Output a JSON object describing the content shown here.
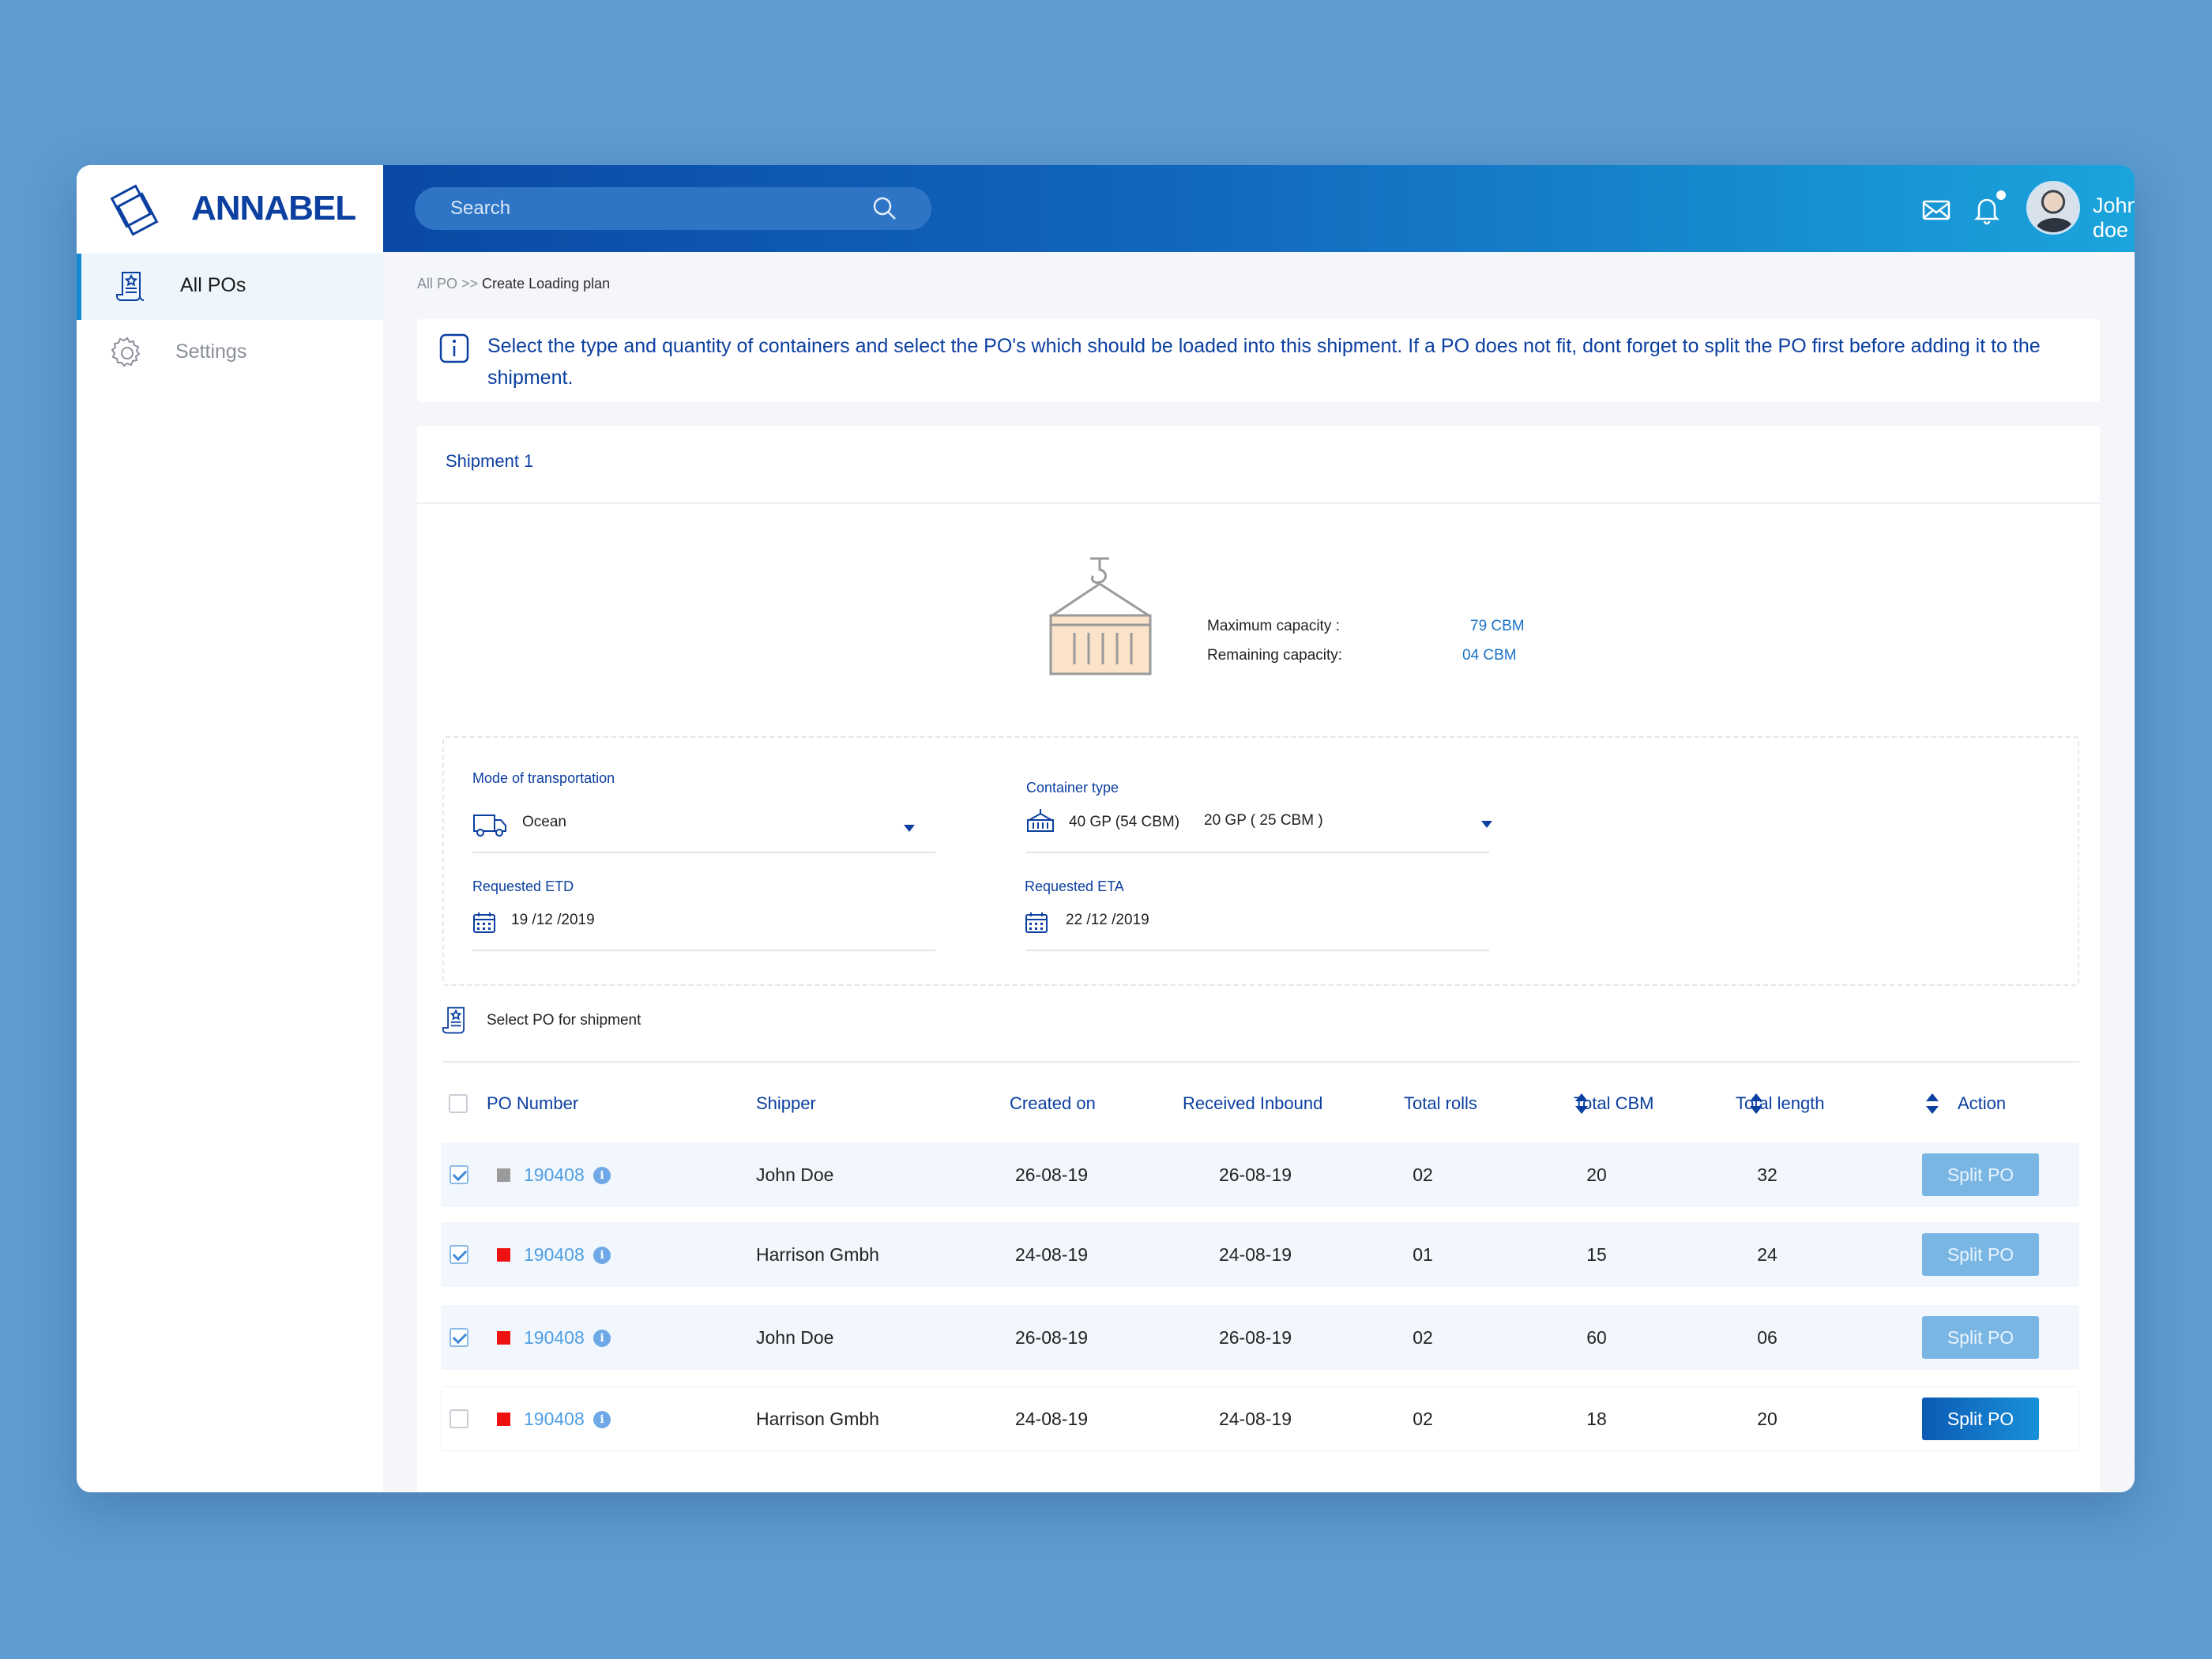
{
  "brand": {
    "name": "ANNABEL",
    "accent": "#0b3fa0"
  },
  "sidebar": {
    "items": [
      {
        "label": "All POs",
        "icon": "document-icon",
        "active": true
      },
      {
        "label": "Settings",
        "icon": "gear-icon",
        "active": false
      }
    ]
  },
  "topbar": {
    "search_placeholder": "Search",
    "icons": [
      "mail-icon",
      "bell-icon"
    ],
    "user": {
      "name": "John doe"
    }
  },
  "breadcrumb": {
    "parent": "All PO >> ",
    "current": "Create Loading plan"
  },
  "info": {
    "message": "Select the type and quantity of containers and select the PO's which should be loaded into this shipment. If a PO does not fit, dont forget to split the PO first before adding it to the shipment."
  },
  "shipment": {
    "title": "Shipment 1",
    "capacity": {
      "max_label": "Maximum capacity :",
      "max_value": "79 CBM",
      "remaining_label": "Remaining capacity:",
      "remaining_value": "04 CBM"
    },
    "form": {
      "mode_label": "Mode of transportation",
      "mode_value": "Ocean",
      "container_label": "Container type",
      "container_value_1": "40 GP (54 CBM)",
      "container_value_2": "20 GP ( 25 CBM )",
      "etd_label": "Requested ETD",
      "etd_value": "19 /12 /2019",
      "eta_label": "Requested ETA",
      "eta_value": "22 /12 /2019"
    },
    "select_title": "Select PO for shipment"
  },
  "table": {
    "headers": {
      "po": "PO Number",
      "shipper": "Shipper",
      "created": "Created on",
      "received": "Received Inbound",
      "rolls": "Total rolls",
      "cbm": "Total CBM",
      "length": "Total length",
      "action": "Action"
    },
    "rows": [
      {
        "checked": true,
        "status_color": "#9b9b9b",
        "po": "190408",
        "shipper": "John Doe",
        "created": "26-08-19",
        "received": "26-08-19",
        "rolls": "02",
        "cbm": "20",
        "length": "32",
        "action": "Split PO"
      },
      {
        "checked": true,
        "status_color": "#ee1111",
        "po": "190408",
        "shipper": "Harrison Gmbh",
        "created": "24-08-19",
        "received": "24-08-19",
        "rolls": "01",
        "cbm": "15",
        "length": "24",
        "action": "Split PO"
      },
      {
        "checked": true,
        "status_color": "#ee1111",
        "po": "190408",
        "shipper": "John Doe",
        "created": "26-08-19",
        "received": "26-08-19",
        "rolls": "02",
        "cbm": "60",
        "length": "06",
        "action": "Split PO"
      },
      {
        "checked": false,
        "status_color": "#ee1111",
        "po": "190408",
        "shipper": "Harrison Gmbh",
        "created": "24-08-19",
        "received": "24-08-19",
        "rolls": "02",
        "cbm": "18",
        "length": "20",
        "action": "Split PO"
      }
    ]
  }
}
